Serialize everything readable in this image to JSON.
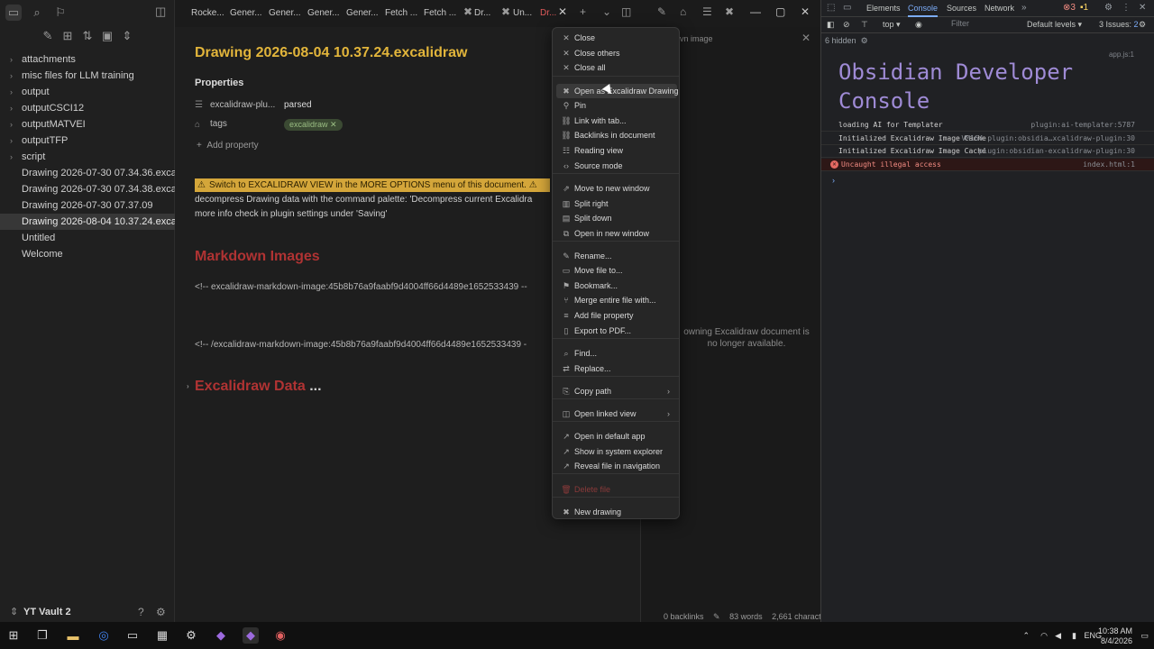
{
  "sidebar": {
    "top_icons": [
      "folder-icon",
      "search-icon",
      "bookmark-icon"
    ],
    "items": [
      {
        "label": "attachments",
        "folder": true
      },
      {
        "label": "misc files for LLM training",
        "folder": true
      },
      {
        "label": "output",
        "folder": true
      },
      {
        "label": "outputCSCI12",
        "folder": true
      },
      {
        "label": "outputMATVEI",
        "folder": true
      },
      {
        "label": "outputTFP",
        "folder": true
      },
      {
        "label": "script",
        "folder": true
      },
      {
        "label": "Drawing 2026-07-30 07.34.36.excalidraw",
        "folder": false
      },
      {
        "label": "Drawing 2026-07-30 07.34.38.excalidraw",
        "folder": false
      },
      {
        "label": "Drawing 2026-07-30 07.37.09",
        "folder": false
      },
      {
        "label": "Drawing 2026-08-04 10.37.24.excalidraw",
        "folder": false,
        "selected": true
      },
      {
        "label": "Untitled",
        "folder": false
      },
      {
        "label": "Welcome",
        "folder": false
      }
    ],
    "vault_name": "YT Vault 2"
  },
  "tabs": [
    "Rocke...",
    "Gener...",
    "Gener...",
    "Gener...",
    "Gener...",
    "Fetch ...",
    "Fetch ...",
    "Dr...",
    "Un...",
    "Dr..."
  ],
  "editor": {
    "title": "Drawing 2026-08-04 10.37.24.excalidraw",
    "properties_heading": "Properties",
    "prop1_key": "excalidraw-plu...",
    "prop1_val": "parsed",
    "prop2_key": "tags",
    "prop2_val": "excalidraw",
    "add_property": "Add property",
    "warning": "Switch to EXCALIDRAW VIEW in the MORE OPTIONS menu of this document.",
    "line2": "decompress Drawing data with the command palette: 'Decompress current Excalidra",
    "line3": "more info check in plugin settings under 'Saving'",
    "h2_images": "Markdown Images",
    "comment1": "<!-- excalidraw-markdown-image:45b8b76a9faabf9d4004ff66d4489e1652533439 --",
    "comment2": "<!-- /excalidraw-markdown-image:45b8b76a9faabf9d4004ff66d4489e1652533439 -",
    "h2_data": "Excalidraw Data",
    "h2_data_more": "..."
  },
  "pane2": {
    "search": "vn image",
    "message": "owning Excalidraw document is no longer available."
  },
  "status": {
    "backlinks": "0 backlinks",
    "words": "83 words",
    "chars": "2,661 characters"
  },
  "context_menu": {
    "items": [
      {
        "label": "Close",
        "icon": "close-icon",
        "glyph": "✕"
      },
      {
        "label": "Close others",
        "icon": "close-icon",
        "glyph": "✕"
      },
      {
        "label": "Close all",
        "icon": "close-icon",
        "glyph": "✕"
      },
      {
        "label": "Open as Excalidraw Drawing",
        "icon": "excalidraw-icon",
        "glyph": "✖"
      },
      {
        "label": "Pin",
        "icon": "pin-icon",
        "glyph": "⚲"
      },
      {
        "label": "Link with tab...",
        "icon": "link-icon",
        "glyph": "⛓"
      },
      {
        "label": "Backlinks in document",
        "icon": "link-icon",
        "glyph": "⛓"
      },
      {
        "label": "Reading view",
        "icon": "book-icon",
        "glyph": "☷"
      },
      {
        "label": "Source mode",
        "icon": "code-icon",
        "glyph": "‹›"
      },
      {
        "label": "Move to new window",
        "icon": "window-icon",
        "glyph": "⇗"
      },
      {
        "label": "Split right",
        "icon": "split-right-icon",
        "glyph": "▥"
      },
      {
        "label": "Split down",
        "icon": "split-down-icon",
        "glyph": "▤"
      },
      {
        "label": "Open in new window",
        "icon": "window-icon",
        "glyph": "⧉"
      },
      {
        "label": "Rename...",
        "icon": "pencil-icon",
        "glyph": "✎"
      },
      {
        "label": "Move file to...",
        "icon": "folder-move-icon",
        "glyph": "▭"
      },
      {
        "label": "Bookmark...",
        "icon": "bookmark-icon",
        "glyph": "⚑"
      },
      {
        "label": "Merge entire file with...",
        "icon": "merge-icon",
        "glyph": "⑂"
      },
      {
        "label": "Add file property",
        "icon": "list-icon",
        "glyph": "≡"
      },
      {
        "label": "Export to PDF...",
        "icon": "file-icon",
        "glyph": "▯"
      },
      {
        "label": "Find...",
        "icon": "search-icon",
        "glyph": "⌕"
      },
      {
        "label": "Replace...",
        "icon": "replace-icon",
        "glyph": "⇄"
      },
      {
        "label": "Copy path",
        "icon": "copy-icon",
        "glyph": "⎘",
        "submenu": true
      },
      {
        "label": "Open linked view",
        "icon": "linked-view-icon",
        "glyph": "◫",
        "submenu": true
      },
      {
        "label": "Open in default app",
        "icon": "external-icon",
        "glyph": "↗"
      },
      {
        "label": "Show in system explorer",
        "icon": "explorer-icon",
        "glyph": "↗"
      },
      {
        "label": "Reveal file in navigation",
        "icon": "reveal-icon",
        "glyph": "↗"
      },
      {
        "label": "Delete file",
        "icon": "trash-icon",
        "glyph": "🗑",
        "danger": true
      },
      {
        "label": "New drawing",
        "icon": "excalidraw-icon",
        "glyph": "✖"
      }
    ]
  },
  "devtools": {
    "tabs": [
      "Elements",
      "Console",
      "Sources",
      "Network"
    ],
    "active_tab": "Console",
    "errors_count": "3",
    "warn_count": "1",
    "context": "top",
    "filter_placeholder": "Filter",
    "levels": "Default levels",
    "issues": "3 Issues:",
    "issues_count": "2",
    "hidden": "6 hidden",
    "app_source": "app.js:1",
    "big_title": "Obsidian Developer Console",
    "logs": [
      {
        "msg": "loading AI for Templater",
        "src": "plugin:ai-templater:5787",
        "error": false
      },
      {
        "msg": "Initialized Excalidraw Image Cache",
        "src": "VM164 plugin:obsidia…xcalidraw-plugin:30",
        "error": false
      },
      {
        "msg": "Initialized Excalidraw Image Cache",
        "src": "plugin:obsidian-excalidraw-plugin:30",
        "error": false
      },
      {
        "msg": "Uncaught illegal access",
        "src": "index.html:1",
        "error": true
      }
    ]
  },
  "taskbar": {
    "lang": "ENG",
    "time": "10:38 AM",
    "date": "8/4/2026"
  }
}
